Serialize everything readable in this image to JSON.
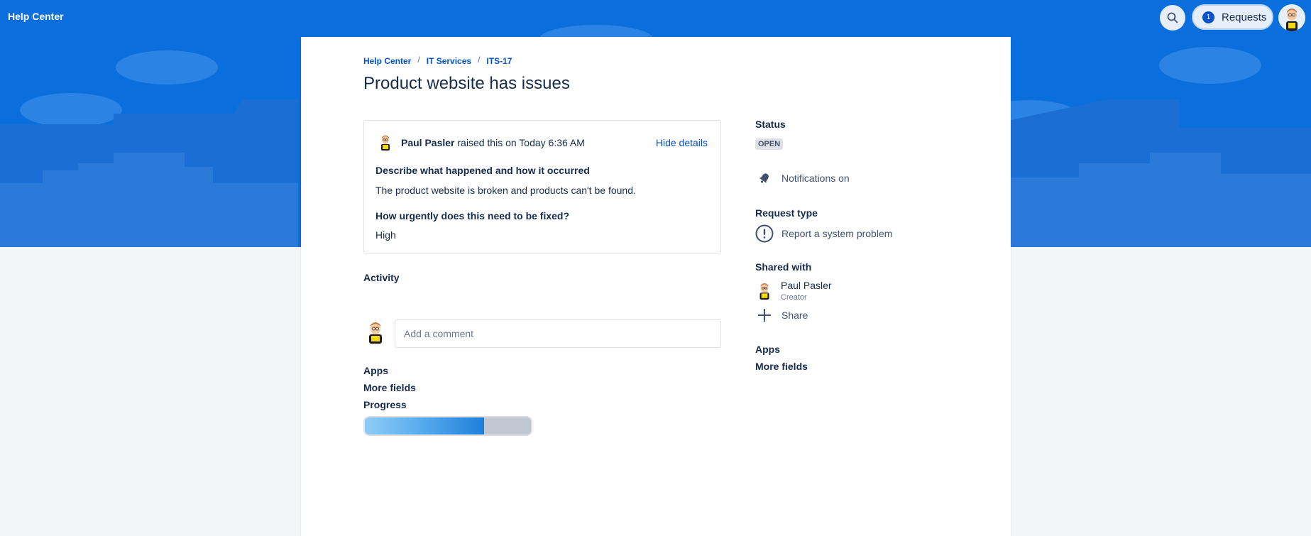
{
  "topbar": {
    "brand": "Help Center",
    "requests_label": "Requests",
    "requests_count": "1"
  },
  "breadcrumb": [
    "Help Center",
    "IT Services",
    "ITS-17"
  ],
  "request": {
    "title": "Product website has issues",
    "raiser_name": "Paul Pasler",
    "raised_text": "raised this on Today 6:36 AM",
    "hide_details": "Hide details",
    "fields": [
      {
        "label": "Describe what happened and how it occurred",
        "value": "The product website is broken and products can't be found."
      },
      {
        "label": "How urgently does this need to be fixed?",
        "value": "High"
      }
    ]
  },
  "activity": {
    "label": "Activity",
    "comment_placeholder": "Add a comment"
  },
  "left_links": {
    "apps": "Apps",
    "more_fields": "More fields",
    "progress": "Progress"
  },
  "progress": {
    "fraction": 0.72
  },
  "sidebar": {
    "status_label": "Status",
    "status_value": "OPEN",
    "notifications": "Notifications on",
    "request_type_label": "Request type",
    "request_type": "Report a system problem",
    "shared_with_label": "Shared with",
    "shared_name": "Paul Pasler",
    "shared_role": "Creator",
    "share": "Share",
    "apps": "Apps",
    "more_fields": "More fields"
  },
  "colors": {
    "banner": "#0a6fdd",
    "link": "#0052cc",
    "text": "#172b4d"
  }
}
